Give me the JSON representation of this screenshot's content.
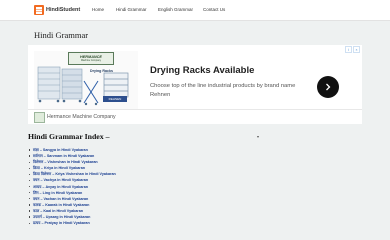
{
  "site": {
    "name": "HindiStudent"
  },
  "nav": {
    "items": [
      "Home",
      "Hindi Grammar",
      "English Grammar",
      "Contact Us"
    ]
  },
  "page": {
    "title": "Hindi Grammar"
  },
  "ad": {
    "brand_logo_text": "HERMANCE",
    "brand_logo_sub": "Machine Company",
    "image_label": "Drying Racks",
    "image_brand": "REHNEN",
    "headline": "Drying Racks Available",
    "description": "Choose top of the line industrial products by brand name Rehnen",
    "advertiser": "Hermance Machine Company",
    "badge_info": "i",
    "badge_close": "×",
    "cta_icon": "chevron-right"
  },
  "index": {
    "heading": "Hindi Grammar Index –",
    "items": [
      "संज्ञा – Sangya in Hindi Vyakaran",
      "सर्वनाम – Sarvnam in Hindi Vyakaran",
      "विशेषण – Visheshan in Hindi Vyakaran",
      "क्रिया – Kriya in Hindi Vyakaran",
      "क्रिया विशेषण – Kriya Visheshan in Hindi Vyakaran",
      "वचन – Vachya in Hindi Vyakaran",
      "अव्यय – Avyay in Hindi Vyakaran",
      "लिंग – Ling in Hindi Vyakaran",
      "वचन – Vachan in Hindi Vyakaran",
      "कारक – Kaarak in Hindi Vyakaran",
      "काल – Kaal in Hindi Vyakaran",
      "उपसर्ग – Upsarg in Hindi Vyakaran",
      "प्रत्यय – Pratyay in Hindi Vyakaran"
    ]
  }
}
